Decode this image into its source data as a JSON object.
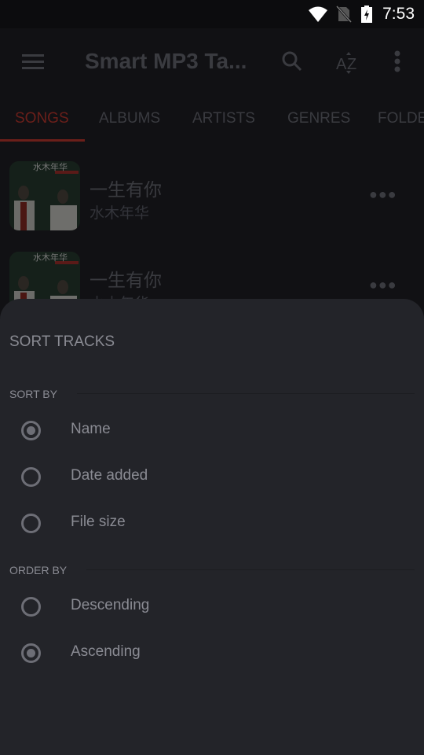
{
  "status_bar": {
    "time": "7:53",
    "icons": [
      "wifi-icon",
      "no-sim-icon",
      "battery-charging-icon"
    ]
  },
  "app_bar": {
    "title": "Smart MP3 Ta...",
    "icons": [
      "menu-icon",
      "search-icon",
      "sort-az-icon",
      "more-vert-icon"
    ]
  },
  "tabs": [
    {
      "label": "SONGS",
      "active": true
    },
    {
      "label": "ALBUMS",
      "active": false
    },
    {
      "label": "ARTISTS",
      "active": false
    },
    {
      "label": "GENRES",
      "active": false
    },
    {
      "label": "FOLDE",
      "active": false
    }
  ],
  "songs": [
    {
      "title": "一生有你",
      "artist": "水木年华",
      "art_text": "水木年华"
    },
    {
      "title": "一生有你",
      "artist": "水木年华",
      "art_text": "水木年华"
    }
  ],
  "sheet": {
    "title": "SORT TRACKS",
    "sort_by": {
      "label": "SORT BY",
      "options": [
        {
          "label": "Name",
          "selected": true
        },
        {
          "label": "Date added",
          "selected": false
        },
        {
          "label": "File size",
          "selected": false
        }
      ]
    },
    "order_by": {
      "label": "ORDER BY",
      "options": [
        {
          "label": "Descending",
          "selected": false
        },
        {
          "label": "Ascending",
          "selected": true
        }
      ]
    }
  },
  "colors": {
    "accent": "#6b1f1a",
    "sheet_bg": "#232429",
    "text_muted": "#8a8b93"
  }
}
